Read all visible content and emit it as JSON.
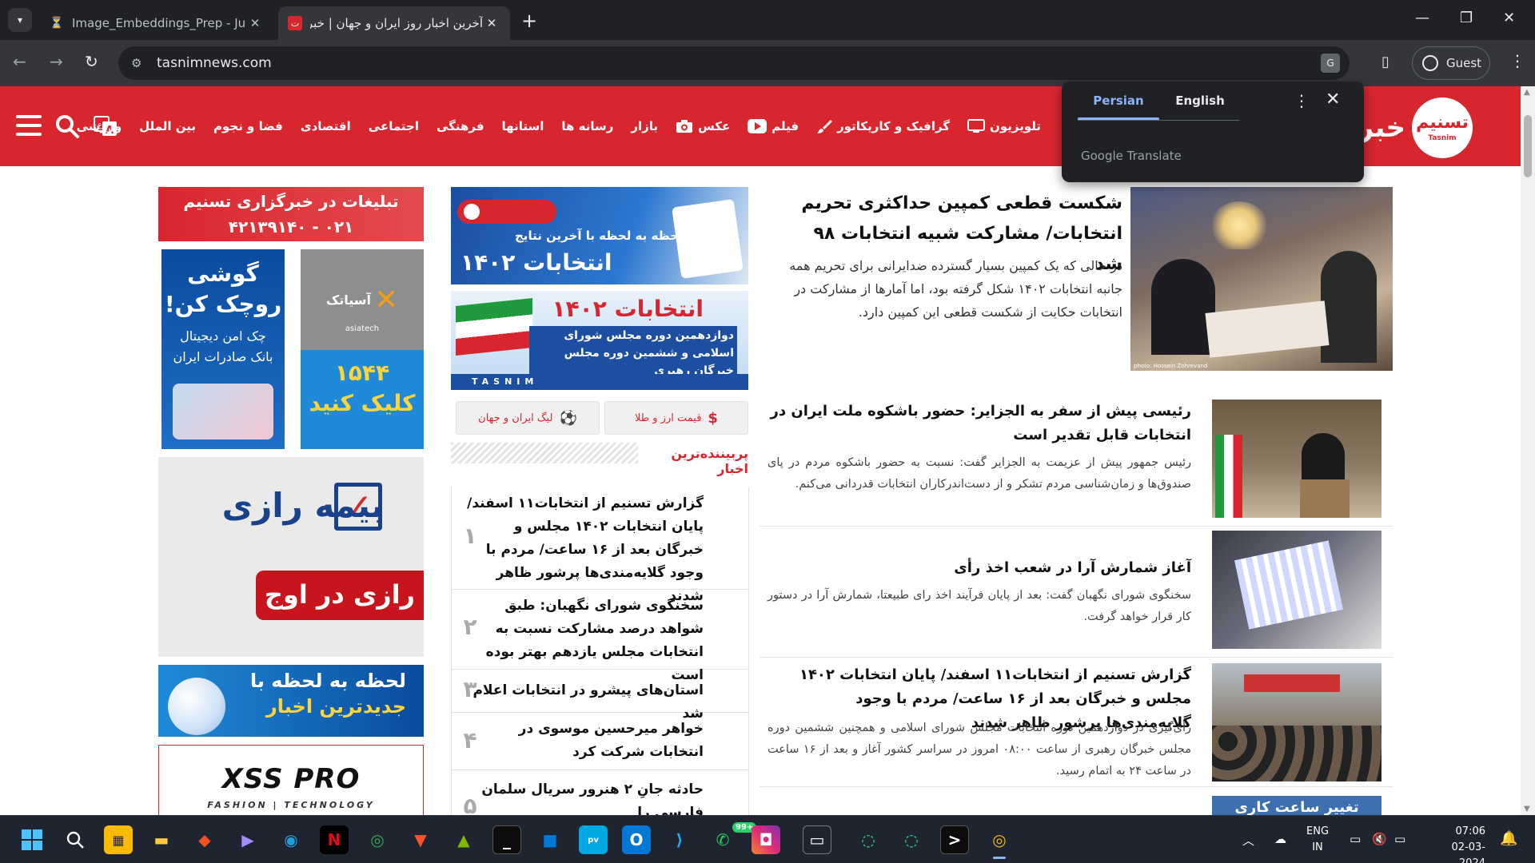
{
  "browser": {
    "tabs": [
      {
        "title": "Image_Embeddings_Prep - Jupy",
        "icon": "jupyter-icon",
        "active": false
      },
      {
        "title": "آخرین اخبار روز ایران و جهان | خبرگ",
        "icon": "tasnim-favicon",
        "active": true
      }
    ],
    "url": "tasnimnews.com",
    "profile_label": "Guest"
  },
  "translate_popup": {
    "source_lang": "Persian",
    "target_lang": "English",
    "brand": "Google Translate"
  },
  "site": {
    "brand": "خبرگزاری",
    "logo_text": "تسنیم",
    "logo_sub": "Tasnim",
    "accent": "#d8262f",
    "nav": [
      {
        "label": "ورزشی",
        "icon": ""
      },
      {
        "label": "بین الملل",
        "icon": ""
      },
      {
        "label": "فضا و نجوم",
        "icon": ""
      },
      {
        "label": "اقتصادی",
        "icon": ""
      },
      {
        "label": "اجتماعی",
        "icon": ""
      },
      {
        "label": "فرهنگی",
        "icon": ""
      },
      {
        "label": "استانها",
        "icon": ""
      },
      {
        "label": "رسانه ها",
        "icon": ""
      },
      {
        "label": "بازار",
        "icon": ""
      },
      {
        "label": "عکس",
        "icon": "camera-icon"
      },
      {
        "label": "فیلم",
        "icon": "play-icon"
      },
      {
        "label": "گرافیک و کاریکاتور",
        "icon": "brush-icon"
      },
      {
        "label": "تلویزیون",
        "icon": "tv-icon"
      }
    ]
  },
  "featured": {
    "title": "شکست قطعی کمپین حداکثری تحریم انتخابات/ مشارکت شبیه انتخابات ۹۸ شد",
    "summary": "در حالی که یک کمپین بسیار گسترده ضدایرانی برای تحریم همه جانبه انتخابات ۱۴۰۲ شکل گرفته بود، اما آمارها از مشارکت در انتخابات حکایت از شکست قطعی این کمپین دارد.",
    "photo_credit": "photo: Hossein Zohrevand"
  },
  "news": [
    {
      "title": "رئیسی پیش از سفر به الجزایر: حضور باشکوه ملت ایران در انتخابات قابل تقدیر است",
      "summary": "رئیس جمهور پیش از عزیمت به الجزایر گفت: نسبت به حضور باشکوه مردم در پای صندوق‌ها و زمان‌شناسی مردم تشکر و از دست‌اندرکاران انتخابات قدردانی می‌کنم."
    },
    {
      "title": "آغاز شمارش آرا در شعب اخذ رأی",
      "summary": "سخنگوی شورای نگهبان گفت: بعد از پایان فرآیند اخذ رای طبیعتا، شمارش آرا در دستور کار قرار خواهد گرفت."
    },
    {
      "title": "گزارش تسنیم از انتخابات۱۱ اسفند/ پایان انتخابات ۱۴۰۲ مجلس و خبرگان بعد از ۱۶ ساعت/ مردم با وجود گلایه‌مندی‌ها پرشور ظاهر شدند",
      "summary": "رأی‌گیری در دوازدهمین دوره انتخابات مجلس شورای اسلامی و همچنین ششمین دوره مجلس خبرگان رهبری از ساعت ۰۸:۰۰ امروز در سراسر کشور آغاز و بعد از ۱۶ ساعت در ساعت ۲۴ به اتمام رسید."
    },
    {
      "title": "",
      "summary": "",
      "thumb_label": "تغییر ساعت کاری"
    }
  ],
  "middle": {
    "banner1_line1": "لحظه به لحظه با آخرین نتایج",
    "banner1_line2": "انتخابات ۱۴۰۲",
    "banner2_title": "انتخابات ۱۴۰۲",
    "banner2_sub": "دوازدهمین دوره مجلس شورای اسلامی و ششمین دوره مجلس خبرگان رهبری",
    "banner2_brand": "TASNIM",
    "pill_currency": "قیمت ارز و طلا",
    "pill_league": "لیگ ایران و جهان",
    "most_viewed_title": "پربیننده‌ترین اخبار",
    "most_viewed": [
      {
        "num": "۱",
        "title": "گزارش تسنیم از انتخابات۱۱ اسفند/ پایان انتخابات ۱۴۰۲ مجلس و خبرگان بعد از ۱۶ ساعت/ مردم با وجود گلایه‌مندی‌ها پرشور ظاهر شدند"
      },
      {
        "num": "۲",
        "title": "سخنگوی شورای نگهبان: طبق شواهد درصد مشارکت نسبت به انتخابات مجلس یازدهم بهتر بوده است"
      },
      {
        "num": "۳",
        "title": "استان‌های پیشرو در انتخابات اعلام شد"
      },
      {
        "num": "۴",
        "title": "خواهر میرحسین موسوی در انتخابات شرکت کرد"
      },
      {
        "num": "۵",
        "title": "حادثه جانِ ۲ هنرور سریال سلمان فارسی را"
      }
    ]
  },
  "ads": {
    "top_line1": "تبلیغات در خبرگزاری تسنیم",
    "top_line2": "۰۲۱ - ۴۲۱۳۹۱۴۰",
    "asia_brand": "آسیاتک",
    "asia_sub": "asiatech",
    "asia_call": "۱۵۴۴",
    "asia_cta": "کلیک کنید",
    "phone_line1": "گوشی",
    "phone_line2": "روچک کن!",
    "phone_line3": "چک امن دیجیتال",
    "phone_line4": "بانک صادرات ایران",
    "bime_logo": "بیمه رازی",
    "bime_slogan": "رازی در اوج",
    "moment_line1": "لحظه به لحظه با",
    "moment_line2": "جدیدترین اخبار",
    "xss_title": "XSS PRO",
    "xss_sub": "FASHION | TECHNOLOGY"
  },
  "taskbar": {
    "lang_line1": "ENG",
    "lang_line2": "IN",
    "time": "07:06",
    "date": "02-03-2024",
    "whatsapp_badge": "99+"
  }
}
